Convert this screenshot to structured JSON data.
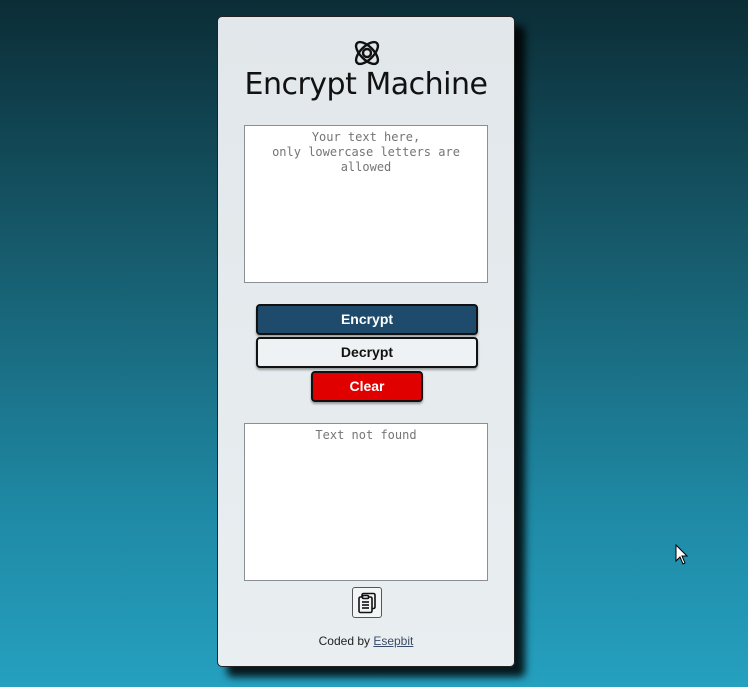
{
  "app": {
    "title": "Encrypt Machine",
    "logo_icon": "atom-icon"
  },
  "input": {
    "placeholder": "Your text here,\nonly lowercase letters are allowed",
    "value": ""
  },
  "buttons": {
    "encrypt_label": "Encrypt",
    "decrypt_label": "Decrypt",
    "clear_label": "Clear"
  },
  "output": {
    "text": "Text not found",
    "copy_icon": "clipboard-icon"
  },
  "footer": {
    "prefix": "Coded by ",
    "author": "Esepbit"
  },
  "colors": {
    "encrypt_button": "#1e4a6b",
    "clear_button": "#e10000",
    "background_top": "#0b2d36",
    "background_bottom": "#25a0bf"
  }
}
